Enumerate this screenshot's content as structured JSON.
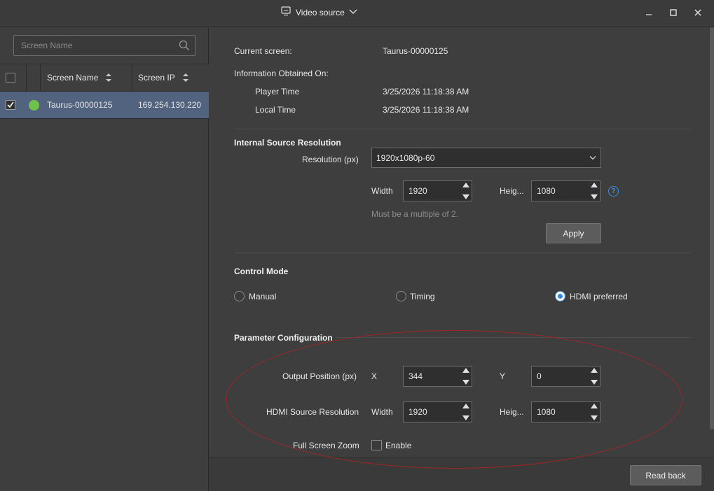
{
  "window": {
    "title": "Video source"
  },
  "search": {
    "placeholder": "Screen Name"
  },
  "table": {
    "columns": [
      "Screen Name",
      "Screen IP"
    ],
    "rows": [
      {
        "checked": true,
        "status": "online",
        "name": "Taurus-00000125",
        "ip": "169.254.130.220"
      }
    ]
  },
  "info": {
    "current_screen_label": "Current screen:",
    "current_screen_value": "Taurus-00000125",
    "obtained_label": "Information Obtained On:",
    "player_time_label": "Player Time",
    "player_time_value": "3/25/2026 11:18:38 AM",
    "local_time_label": "Local Time",
    "local_time_value": "3/25/2026 11:18:38 AM"
  },
  "internal": {
    "title": "Internal Source Resolution",
    "resolution_label": "Resolution (px)",
    "resolution_value": "1920x1080p-60",
    "width_label": "Width",
    "width_value": "1920",
    "height_label": "Heig...",
    "height_value": "1080",
    "hint": "Must be a multiple of 2.",
    "apply_label": "Apply"
  },
  "control_mode": {
    "title": "Control Mode",
    "options": [
      {
        "label": "Manual",
        "selected": false
      },
      {
        "label": "Timing",
        "selected": false
      },
      {
        "label": "HDMI preferred",
        "selected": true
      }
    ]
  },
  "params": {
    "title": "Parameter Configuration",
    "output_position_label": "Output Position (px)",
    "x_label": "X",
    "x_value": "344",
    "y_label": "Y",
    "y_value": "0",
    "hdmi_label": "HDMI Source Resolution",
    "width_label": "Width",
    "width_value": "1920",
    "height_label": "Heig...",
    "height_value": "1080",
    "zoom_label": "Full Screen Zoom",
    "enable_label": "Enable",
    "enable_checked": false
  },
  "footer": {
    "read_back_label": "Read back"
  },
  "colors": {
    "accent": "#2d86e8",
    "selected_row": "#51637f",
    "status_online": "#6cc24a",
    "annotation": "#a1252a"
  }
}
